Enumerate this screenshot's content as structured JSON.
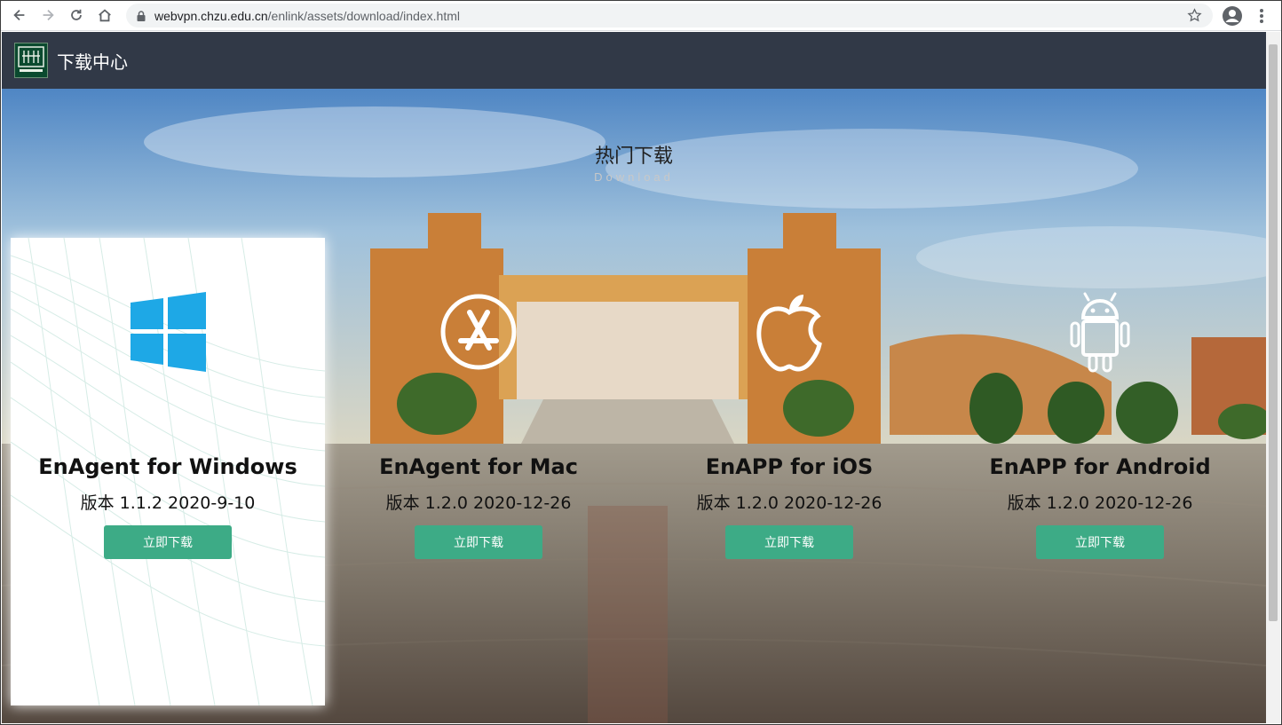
{
  "browser": {
    "url_host": "webvpn.chzu.edu.cn",
    "url_path": "/enlink/assets/download/index.html"
  },
  "header": {
    "title": "下载中心"
  },
  "section": {
    "title": "热门下载",
    "subtitle": "Download"
  },
  "cards": [
    {
      "name": "EnAgent for Windows",
      "version": "版本 1.1.2 2020-9-10",
      "button": "立即下载",
      "icon": "windows-icon",
      "active": true
    },
    {
      "name": "EnAgent for Mac",
      "version": "版本 1.2.0 2020-12-26",
      "button": "立即下载",
      "icon": "app-store-icon",
      "active": false
    },
    {
      "name": "EnAPP for iOS",
      "version": "版本 1.2.0 2020-12-26",
      "button": "立即下载",
      "icon": "apple-icon",
      "active": false
    },
    {
      "name": "EnAPP for Android",
      "version": "版本 1.2.0 2020-12-26",
      "button": "立即下载",
      "icon": "android-icon",
      "active": false
    }
  ],
  "colors": {
    "topbar": "#313947",
    "button": "#3dab86",
    "windows_blue": "#1ea8e6"
  }
}
